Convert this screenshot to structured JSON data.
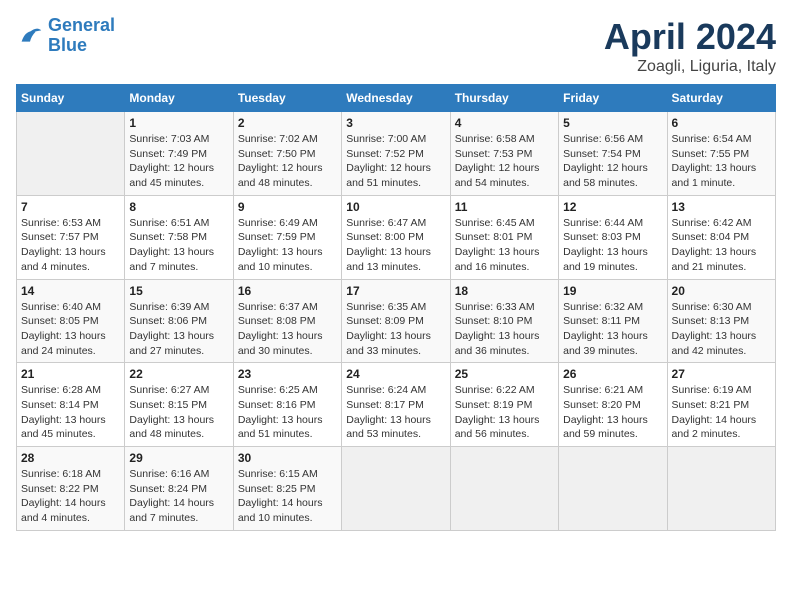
{
  "header": {
    "logo_line1": "General",
    "logo_line2": "Blue",
    "title": "April 2024",
    "subtitle": "Zoagli, Liguria, Italy"
  },
  "weekdays": [
    "Sunday",
    "Monday",
    "Tuesday",
    "Wednesday",
    "Thursday",
    "Friday",
    "Saturday"
  ],
  "weeks": [
    [
      {
        "day": "",
        "info": ""
      },
      {
        "day": "1",
        "info": "Sunrise: 7:03 AM\nSunset: 7:49 PM\nDaylight: 12 hours\nand 45 minutes."
      },
      {
        "day": "2",
        "info": "Sunrise: 7:02 AM\nSunset: 7:50 PM\nDaylight: 12 hours\nand 48 minutes."
      },
      {
        "day": "3",
        "info": "Sunrise: 7:00 AM\nSunset: 7:52 PM\nDaylight: 12 hours\nand 51 minutes."
      },
      {
        "day": "4",
        "info": "Sunrise: 6:58 AM\nSunset: 7:53 PM\nDaylight: 12 hours\nand 54 minutes."
      },
      {
        "day": "5",
        "info": "Sunrise: 6:56 AM\nSunset: 7:54 PM\nDaylight: 12 hours\nand 58 minutes."
      },
      {
        "day": "6",
        "info": "Sunrise: 6:54 AM\nSunset: 7:55 PM\nDaylight: 13 hours\nand 1 minute."
      }
    ],
    [
      {
        "day": "7",
        "info": "Sunrise: 6:53 AM\nSunset: 7:57 PM\nDaylight: 13 hours\nand 4 minutes."
      },
      {
        "day": "8",
        "info": "Sunrise: 6:51 AM\nSunset: 7:58 PM\nDaylight: 13 hours\nand 7 minutes."
      },
      {
        "day": "9",
        "info": "Sunrise: 6:49 AM\nSunset: 7:59 PM\nDaylight: 13 hours\nand 10 minutes."
      },
      {
        "day": "10",
        "info": "Sunrise: 6:47 AM\nSunset: 8:00 PM\nDaylight: 13 hours\nand 13 minutes."
      },
      {
        "day": "11",
        "info": "Sunrise: 6:45 AM\nSunset: 8:01 PM\nDaylight: 13 hours\nand 16 minutes."
      },
      {
        "day": "12",
        "info": "Sunrise: 6:44 AM\nSunset: 8:03 PM\nDaylight: 13 hours\nand 19 minutes."
      },
      {
        "day": "13",
        "info": "Sunrise: 6:42 AM\nSunset: 8:04 PM\nDaylight: 13 hours\nand 21 minutes."
      }
    ],
    [
      {
        "day": "14",
        "info": "Sunrise: 6:40 AM\nSunset: 8:05 PM\nDaylight: 13 hours\nand 24 minutes."
      },
      {
        "day": "15",
        "info": "Sunrise: 6:39 AM\nSunset: 8:06 PM\nDaylight: 13 hours\nand 27 minutes."
      },
      {
        "day": "16",
        "info": "Sunrise: 6:37 AM\nSunset: 8:08 PM\nDaylight: 13 hours\nand 30 minutes."
      },
      {
        "day": "17",
        "info": "Sunrise: 6:35 AM\nSunset: 8:09 PM\nDaylight: 13 hours\nand 33 minutes."
      },
      {
        "day": "18",
        "info": "Sunrise: 6:33 AM\nSunset: 8:10 PM\nDaylight: 13 hours\nand 36 minutes."
      },
      {
        "day": "19",
        "info": "Sunrise: 6:32 AM\nSunset: 8:11 PM\nDaylight: 13 hours\nand 39 minutes."
      },
      {
        "day": "20",
        "info": "Sunrise: 6:30 AM\nSunset: 8:13 PM\nDaylight: 13 hours\nand 42 minutes."
      }
    ],
    [
      {
        "day": "21",
        "info": "Sunrise: 6:28 AM\nSunset: 8:14 PM\nDaylight: 13 hours\nand 45 minutes."
      },
      {
        "day": "22",
        "info": "Sunrise: 6:27 AM\nSunset: 8:15 PM\nDaylight: 13 hours\nand 48 minutes."
      },
      {
        "day": "23",
        "info": "Sunrise: 6:25 AM\nSunset: 8:16 PM\nDaylight: 13 hours\nand 51 minutes."
      },
      {
        "day": "24",
        "info": "Sunrise: 6:24 AM\nSunset: 8:17 PM\nDaylight: 13 hours\nand 53 minutes."
      },
      {
        "day": "25",
        "info": "Sunrise: 6:22 AM\nSunset: 8:19 PM\nDaylight: 13 hours\nand 56 minutes."
      },
      {
        "day": "26",
        "info": "Sunrise: 6:21 AM\nSunset: 8:20 PM\nDaylight: 13 hours\nand 59 minutes."
      },
      {
        "day": "27",
        "info": "Sunrise: 6:19 AM\nSunset: 8:21 PM\nDaylight: 14 hours\nand 2 minutes."
      }
    ],
    [
      {
        "day": "28",
        "info": "Sunrise: 6:18 AM\nSunset: 8:22 PM\nDaylight: 14 hours\nand 4 minutes."
      },
      {
        "day": "29",
        "info": "Sunrise: 6:16 AM\nSunset: 8:24 PM\nDaylight: 14 hours\nand 7 minutes."
      },
      {
        "day": "30",
        "info": "Sunrise: 6:15 AM\nSunset: 8:25 PM\nDaylight: 14 hours\nand 10 minutes."
      },
      {
        "day": "",
        "info": ""
      },
      {
        "day": "",
        "info": ""
      },
      {
        "day": "",
        "info": ""
      },
      {
        "day": "",
        "info": ""
      }
    ]
  ]
}
